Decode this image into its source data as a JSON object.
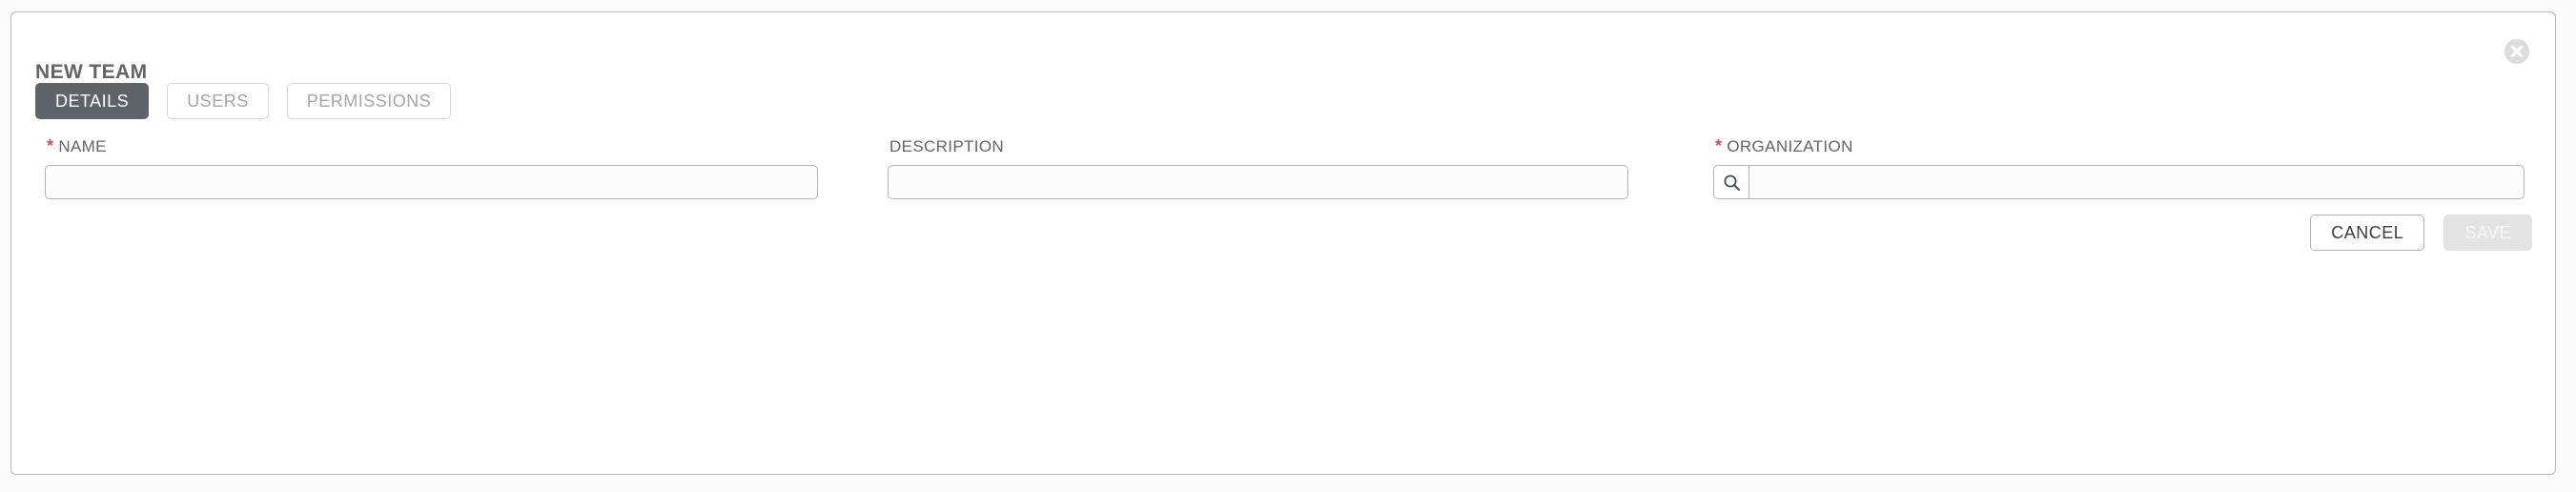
{
  "panel": {
    "title": "NEW TEAM",
    "close_icon": "close-circle-icon"
  },
  "tabs": [
    {
      "label": "DETAILS",
      "active": true
    },
    {
      "label": "USERS",
      "active": false
    },
    {
      "label": "PERMISSIONS",
      "active": false
    }
  ],
  "form": {
    "required_marker": "*",
    "fields": [
      {
        "key": "name",
        "label": "NAME",
        "required": true,
        "value": "",
        "placeholder": ""
      },
      {
        "key": "description",
        "label": "DESCRIPTION",
        "required": false,
        "value": "",
        "placeholder": ""
      },
      {
        "key": "organization",
        "label": "ORGANIZATION",
        "required": true,
        "value": "",
        "placeholder": "",
        "lookup_icon": "search-icon"
      }
    ]
  },
  "footer": {
    "cancel_label": "CANCEL",
    "save_label": "SAVE",
    "save_disabled": true
  },
  "colors": {
    "page_background": "#fbfbfb",
    "card_background": "#ffffff",
    "card_border": "#b7b7b7",
    "title_text": "#646464",
    "tab_active_background": "#5f646b",
    "tab_active_text": "#ffffff",
    "tab_inactive_text": "#a6a6a6",
    "tab_inactive_border": "#d7d7d7",
    "required_star": "#c9514f",
    "input_background": "#fcfcfc",
    "input_border": "#b4b4b4",
    "save_disabled_background": "#e3e3e3",
    "save_disabled_text": "#f7f7f7",
    "close_icon": "#dcdcdc"
  }
}
